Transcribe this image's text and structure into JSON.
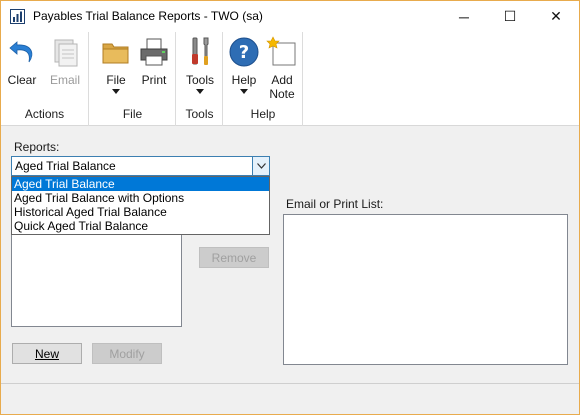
{
  "window": {
    "title": "Payables Trial Balance Reports  -  TWO (sa)",
    "controls": {
      "minimize": "─",
      "maximize": "☐",
      "close": "✕"
    },
    "border_color": "#e8ab4d"
  },
  "ribbon": {
    "groups": [
      {
        "label": "Actions",
        "buttons": [
          {
            "label": "Clear",
            "icon": "clear-undo-icon",
            "enabled": true
          },
          {
            "label": "Email",
            "icon": "email-icon",
            "enabled": false
          }
        ]
      },
      {
        "label": "File",
        "buttons": [
          {
            "label": "File",
            "icon": "folder-icon",
            "dropdown": true
          },
          {
            "label": "Print",
            "icon": "printer-icon"
          }
        ]
      },
      {
        "label": "Tools",
        "buttons": [
          {
            "label": "Tools",
            "icon": "tools-icon",
            "dropdown": true
          }
        ]
      },
      {
        "label": "Help",
        "buttons": [
          {
            "label": "Help",
            "icon": "help-icon",
            "dropdown": true
          },
          {
            "label": "Add\nNote",
            "label_line1": "Add",
            "label_line2": "Note",
            "icon": "add-note-icon"
          }
        ]
      }
    ]
  },
  "reports": {
    "label": "Reports:",
    "selected": "Aged Trial Balance",
    "options": [
      "Aged Trial Balance",
      "Aged Trial Balance with Options",
      "Historical Aged Trial Balance",
      "Quick Aged Trial Balance"
    ],
    "highlighted_index": 0
  },
  "buttons": {
    "remove": "Remove",
    "new": "New",
    "modify": "Modify"
  },
  "email_print": {
    "label": "Email or Print List:"
  },
  "colors": {
    "selection": "#0078d7",
    "help_icon": "#2e6db4",
    "clear_icon": "#2a7fd4"
  }
}
